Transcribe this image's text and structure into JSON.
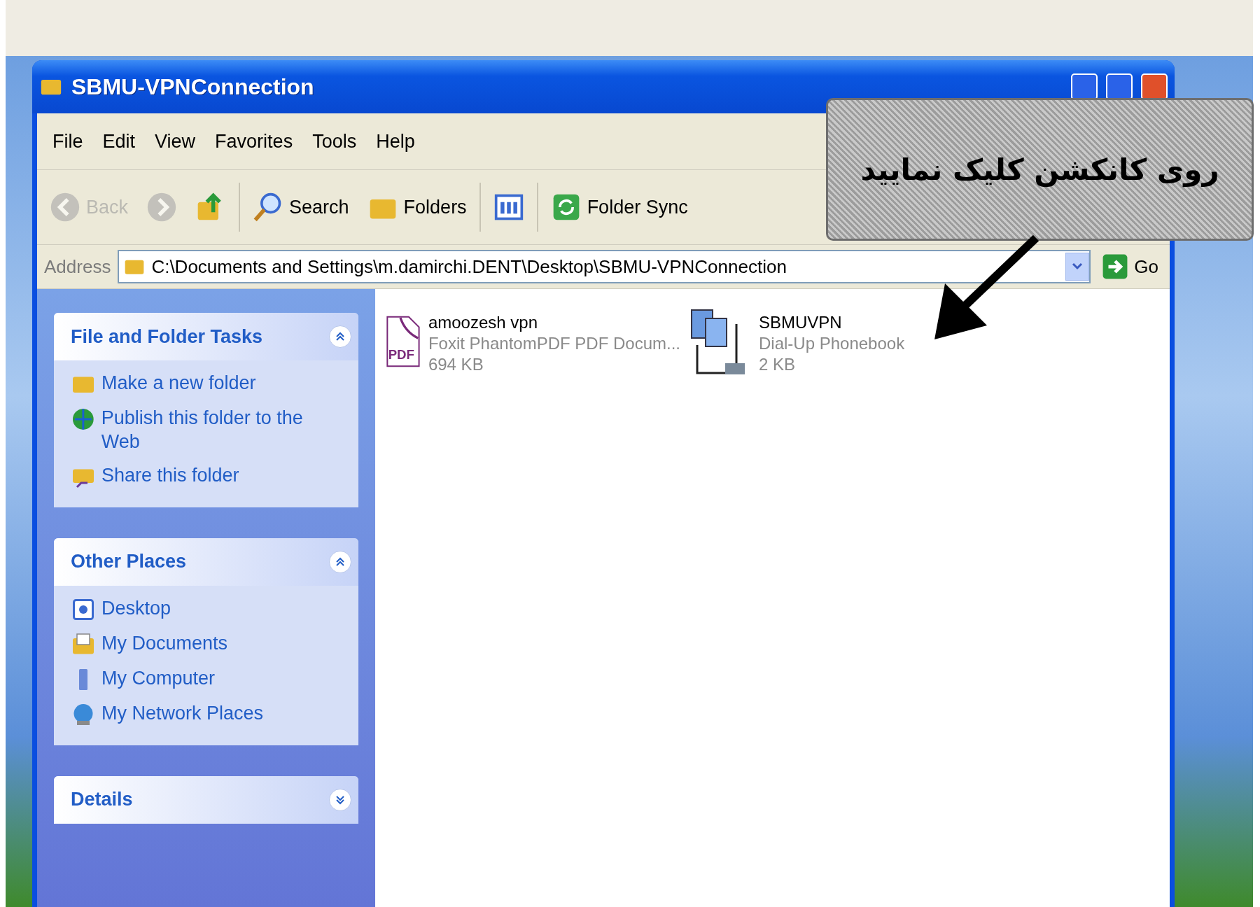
{
  "window": {
    "title": "SBMU-VPNConnection"
  },
  "menu": [
    "File",
    "Edit",
    "View",
    "Favorites",
    "Tools",
    "Help"
  ],
  "toolbar": [
    {
      "kind": "back",
      "label": "Back",
      "disabled": true
    },
    {
      "kind": "forward",
      "disabled": true
    },
    {
      "kind": "up",
      "disabled": false
    },
    {
      "kind": "search",
      "label": "Search",
      "disabled": false
    },
    {
      "kind": "folders",
      "label": "Folders",
      "disabled": false
    },
    {
      "kind": "views",
      "disabled": false
    },
    {
      "kind": "sync",
      "label": "Folder Sync",
      "disabled": false
    }
  ],
  "address": {
    "label": "Address",
    "value": "C:\\Documents and Settings\\m.damirchi.DENT\\Desktop\\SBMU-VPNConnection",
    "go": "Go"
  },
  "task_panels": [
    {
      "title": "File and Folder Tasks",
      "expanded": true,
      "items": [
        {
          "kind": "new-folder",
          "label": "Make a new folder"
        },
        {
          "kind": "publish",
          "label": "Publish this folder to the Web"
        },
        {
          "kind": "share",
          "label": "Share this folder"
        }
      ]
    },
    {
      "title": "Other Places",
      "expanded": true,
      "items": [
        {
          "kind": "desktop",
          "label": "Desktop"
        },
        {
          "kind": "documents",
          "label": "My Documents"
        },
        {
          "kind": "computer",
          "label": "My Computer"
        },
        {
          "kind": "network",
          "label": "My Network Places"
        }
      ]
    },
    {
      "title": "Details",
      "expanded": false
    }
  ],
  "files": [
    {
      "kind": "pdf",
      "icon_text": "PDF",
      "name": "amoozesh vpn",
      "type": "Foxit PhantomPDF PDF Docum...",
      "size": "694 KB"
    },
    {
      "kind": "phonebook",
      "name": "SBMUVPN",
      "type": "Dial-Up Phonebook",
      "size": "2 KB"
    }
  ],
  "callout": {
    "text": "روی کانکشن کلیک نمایید"
  }
}
